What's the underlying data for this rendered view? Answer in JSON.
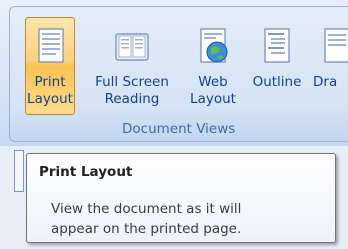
{
  "ribbon": {
    "buttons": [
      {
        "line1": "Print",
        "line2": "Layout",
        "icon": "print-layout-icon"
      },
      {
        "line1": "Full Screen",
        "line2": "Reading",
        "icon": "full-screen-reading-icon"
      },
      {
        "line1": "Web",
        "line2": "Layout",
        "icon": "web-layout-icon"
      },
      {
        "line1": "Outline",
        "line2": "",
        "icon": "outline-icon"
      },
      {
        "line1": "Dra",
        "line2": "",
        "icon": "draft-icon"
      }
    ],
    "group_label": "Document Views"
  },
  "tooltip": {
    "title": "Print Layout",
    "body_line1": "View the document as it will",
    "body_line2": "appear on the printed page."
  },
  "colors": {
    "active_button": "#f9c250",
    "ribbon_text": "#15428b",
    "group_label": "#3e6aaa"
  }
}
